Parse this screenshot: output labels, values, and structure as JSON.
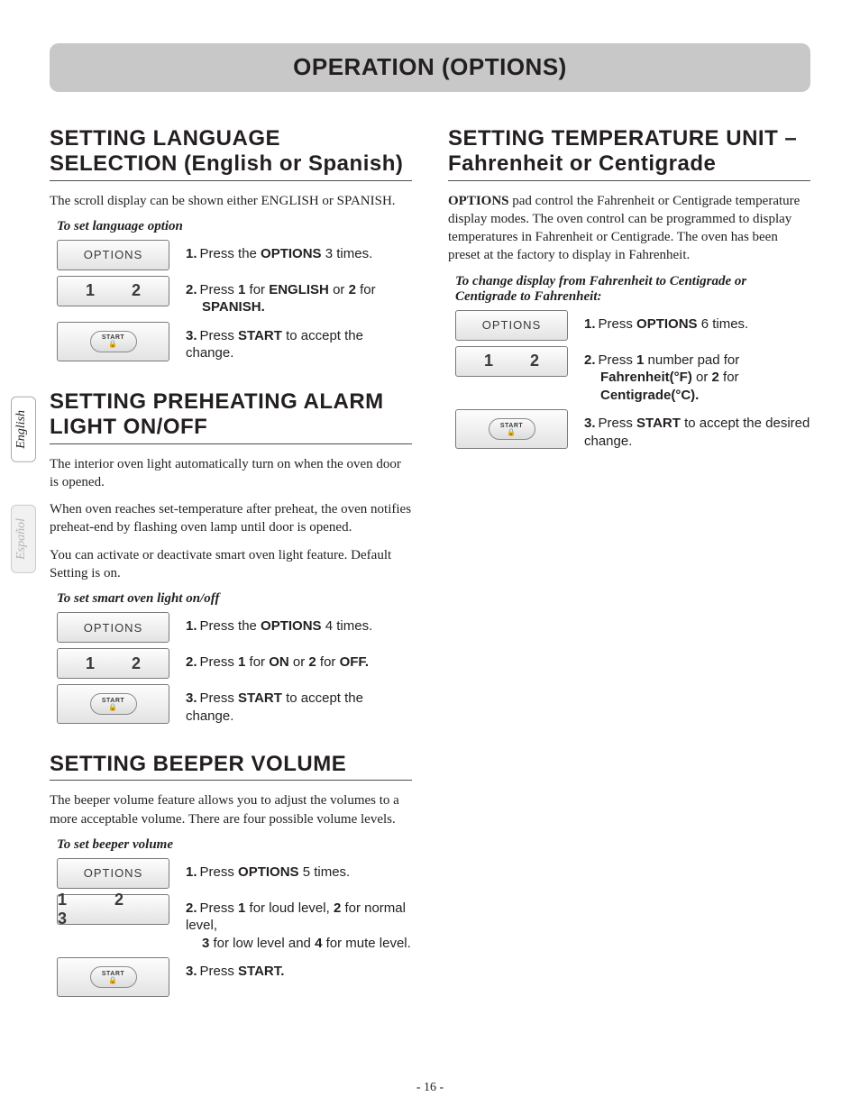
{
  "banner": "OPERATION (OPTIONS)",
  "tabs": {
    "en": "English",
    "es": "Español"
  },
  "btn": {
    "options": "OPTIONS",
    "n12": "1   2",
    "n123": "1   2   3",
    "start": "START"
  },
  "left": {
    "s1": {
      "title": "SETTING LANGUAGE SELECTION (English or Spanish)",
      "p1": "The scroll display can be shown either ENGLISH or SPANISH.",
      "sub": "To set language option",
      "st1a": "Press the ",
      "st1b": "OPTIONS",
      "st1c": " 3 times.",
      "st2a": "Press ",
      "st2b": "1",
      "st2c": " for ",
      "st2d": "ENGLISH",
      "st2e": " or ",
      "st2f": "2",
      "st2g": " for ",
      "st2h": "SPANISH.",
      "st3a": "Press ",
      "st3b": "START",
      "st3c": " to accept the change."
    },
    "s2": {
      "title": "SETTING PREHEATING ALARM LIGHT ON/OFF",
      "p1": "The interior oven light automatically turn on when the oven door is opened.",
      "p2": "When oven reaches set-temperature after preheat, the oven notifies preheat-end by flashing oven lamp until door is opened.",
      "p3": "You can activate or deactivate smart oven light feature. Default Setting is on.",
      "sub": "To set smart oven light on/off",
      "st1a": "Press the ",
      "st1b": "OPTIONS",
      "st1c": " 4 times.",
      "st2a": "Press ",
      "st2b": "1",
      "st2c": " for ",
      "st2d": "ON",
      "st2e": " or ",
      "st2f": "2",
      "st2g": " for ",
      "st2h": "OFF.",
      "st3a": "Press ",
      "st3b": "START",
      "st3c": " to accept the change."
    },
    "s3": {
      "title": "SETTING BEEPER VOLUME",
      "p1": "The beeper volume feature allows you to adjust the volumes to a more acceptable volume. There are four possible volume levels.",
      "sub": "To set beeper volume",
      "st1a": "Press ",
      "st1b": "OPTIONS",
      "st1c": " 5 times.",
      "st2a": "Press ",
      "st2b": "1",
      "st2c": " for loud level, ",
      "st2d": "2",
      "st2e": " for normal level, ",
      "st2f": "3",
      "st2g": " for low level and ",
      "st2h": "4",
      "st2i": " for mute level.",
      "st3a": "Press ",
      "st3b": "START."
    }
  },
  "right": {
    "s1": {
      "title": "SETTING TEMPERATURE UNIT – Fahrenheit or Centigrade",
      "p1a": "OPTIONS",
      "p1b": " pad control the Fahrenheit or Centigrade temperature display modes. The oven control can be programmed to display temperatures in Fahrenheit or Centigrade. The oven has been preset at the factory to display in Fahrenheit.",
      "sub": "To change display from Fahrenheit to Centigrade or Centigrade to Fahrenheit:",
      "st1a": "Press ",
      "st1b": "OPTIONS",
      "st1c": " 6 times.",
      "st2a": "Press ",
      "st2b": "1",
      "st2c": " number pad for ",
      "st2d": "Fahrenheit(°F)",
      "st2e": " or ",
      "st2f": "2",
      "st2g": " for ",
      "st2h": "Centigrade(°C).",
      "st3a": "Press ",
      "st3b": "START",
      "st3c": " to accept the desired change."
    }
  },
  "page": "- 16 -"
}
